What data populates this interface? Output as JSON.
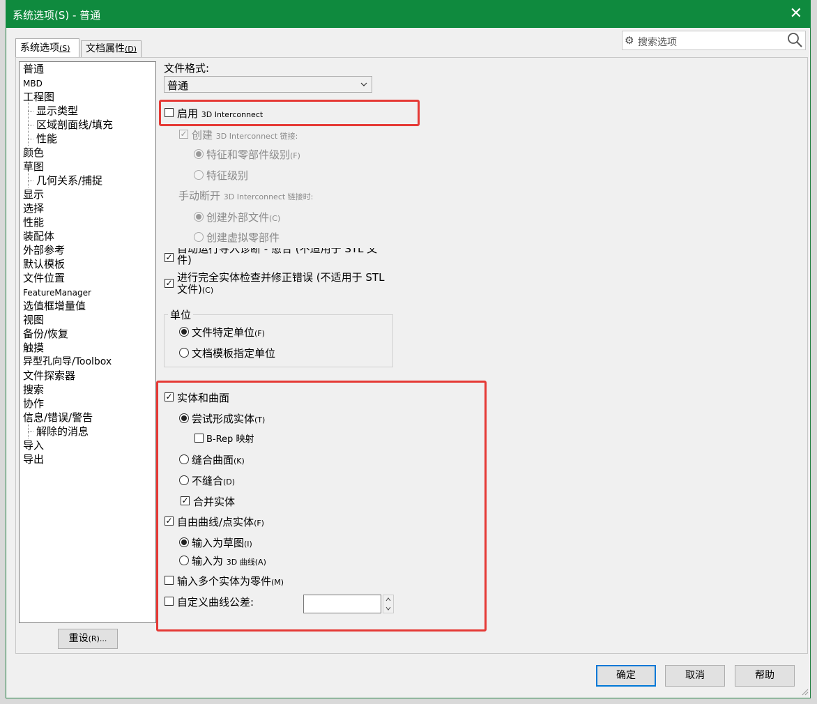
{
  "window": {
    "title": "系统选项(S) - 普通",
    "close_glyph": "✕"
  },
  "tabs": [
    {
      "label": "系统选项",
      "key": "(S)"
    },
    {
      "label": "文档属性",
      "key": "(D)"
    }
  ],
  "search": {
    "placeholder": "搜索选项"
  },
  "tree": {
    "items": [
      {
        "label": "普通"
      },
      {
        "label": "MBD"
      },
      {
        "label": "工程图"
      },
      {
        "label": "显示类型"
      },
      {
        "label": "区域剖面线/填充"
      },
      {
        "label": "性能"
      },
      {
        "label": "颜色"
      },
      {
        "label": "草图"
      },
      {
        "label": "几何关系/捕捉"
      },
      {
        "label": "显示"
      },
      {
        "label": "选择"
      },
      {
        "label": "性能"
      },
      {
        "label": "装配体"
      },
      {
        "label": "外部参考"
      },
      {
        "label": "默认模板"
      },
      {
        "label": "文件位置"
      },
      {
        "label": "FeatureManager"
      },
      {
        "label": "选值框增量值"
      },
      {
        "label": "视图"
      },
      {
        "label": "备份/恢复"
      },
      {
        "label": "触摸"
      },
      {
        "label": "异型孔向导/Toolbox"
      },
      {
        "label": "文件探索器"
      },
      {
        "label": "搜索"
      },
      {
        "label": "协作"
      },
      {
        "label": "信息/错误/警告"
      },
      {
        "label": "解除的消息"
      },
      {
        "label": "导入"
      },
      {
        "label": "导出"
      }
    ]
  },
  "reset_button": {
    "label": "重设",
    "key": "(R)..."
  },
  "main": {
    "file_format_label": "文件格式:",
    "file_format_value": "普通",
    "enable_3d": {
      "label": "启用",
      "suffix": "3D Interconnect",
      "checked": false
    },
    "create_3d_links": {
      "label": "创建",
      "suffix": "3D Interconnect 链接:",
      "checked": true,
      "disabled": true
    },
    "feature_and_part": {
      "label": "特征和零部件级别",
      "key": "(F)"
    },
    "feature_level": {
      "label": "特征级别"
    },
    "manual_break_label_pre": "手动断开",
    "manual_break_label_suf": "3D Interconnect 链接时:",
    "create_external": {
      "label": "创建外部文件",
      "key": "(C)"
    },
    "create_virtual": {
      "label": "创建虚拟零部件"
    },
    "auto_diag": {
      "label": "自动运行导入诊断 - 愈合 (不适用于 STL 文",
      "line2": "件)",
      "checked": true
    },
    "full_check": {
      "label": "进行完全实体检查并修正错误 (不适用于 STL",
      "line2": "文件)",
      "key": "(C)",
      "checked": true
    },
    "units_group": "单位",
    "unit_file": {
      "label": "文件特定单位",
      "key": "(F)",
      "selected": true
    },
    "unit_template": {
      "label": "文档模板指定单位"
    },
    "solid_surface": {
      "label": "实体和曲面",
      "checked": true
    },
    "try_solid": {
      "label": "尝试形成实体",
      "key": "(T)",
      "selected": true
    },
    "brep": {
      "label": "B-Rep 映射",
      "checked": false
    },
    "knit": {
      "label": "缝合曲面",
      "key": "(K)"
    },
    "no_knit": {
      "label": "不缝合",
      "key": "(D)"
    },
    "merge": {
      "label": "合并实体",
      "checked": true
    },
    "free_curves": {
      "label": "自由曲线/点实体",
      "key": "(F)",
      "checked": true
    },
    "as_sketch": {
      "label": "输入为草图",
      "key": "(I)",
      "selected": true
    },
    "as_3d": {
      "label": "输入为",
      "suffix": "3D 曲线",
      "key": "(A)"
    },
    "multi_body": {
      "label": "输入多个实体为零件",
      "key": "(M)",
      "checked": false
    },
    "custom_tol": {
      "label": "自定义曲线公差:",
      "checked": false,
      "value": ""
    }
  },
  "footer": {
    "ok": "确定",
    "cancel": "取消",
    "help": "帮助"
  },
  "colors": {
    "title_bar": "#0f8a3e",
    "highlight_box": "#e53935",
    "default_button_border": "#0078d7"
  }
}
